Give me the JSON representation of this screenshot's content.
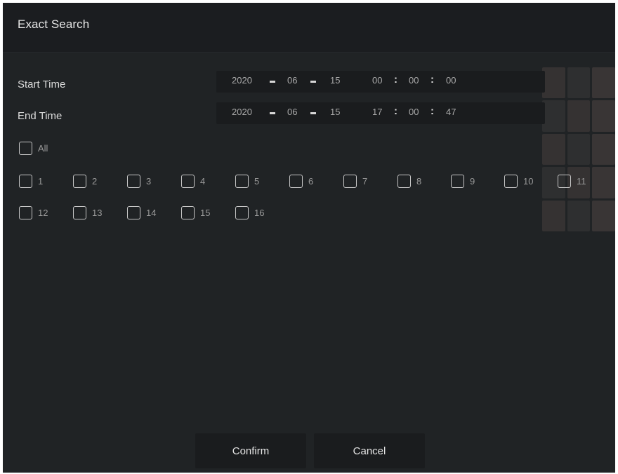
{
  "dialog": {
    "title": "Exact Search"
  },
  "start_time": {
    "label": "Start Time",
    "year": "2020",
    "month": "06",
    "day": "15",
    "hour": "00",
    "minute": "00",
    "second": "00"
  },
  "end_time": {
    "label": "End Time",
    "year": "2020",
    "month": "06",
    "day": "15",
    "hour": "17",
    "minute": "00",
    "second": "47"
  },
  "separators": {
    "date": "-",
    "time": ":"
  },
  "channels": {
    "all_label": "All",
    "items": [
      "1",
      "2",
      "3",
      "4",
      "5",
      "6",
      "7",
      "8",
      "9",
      "10",
      "11",
      "12",
      "13",
      "14",
      "15",
      "16"
    ]
  },
  "buttons": {
    "confirm": "Confirm",
    "cancel": "Cancel"
  },
  "colors": {
    "dialog_bg": "#202325",
    "title_bg": "#1b1d20",
    "field_bg": "#1a1c1e"
  }
}
